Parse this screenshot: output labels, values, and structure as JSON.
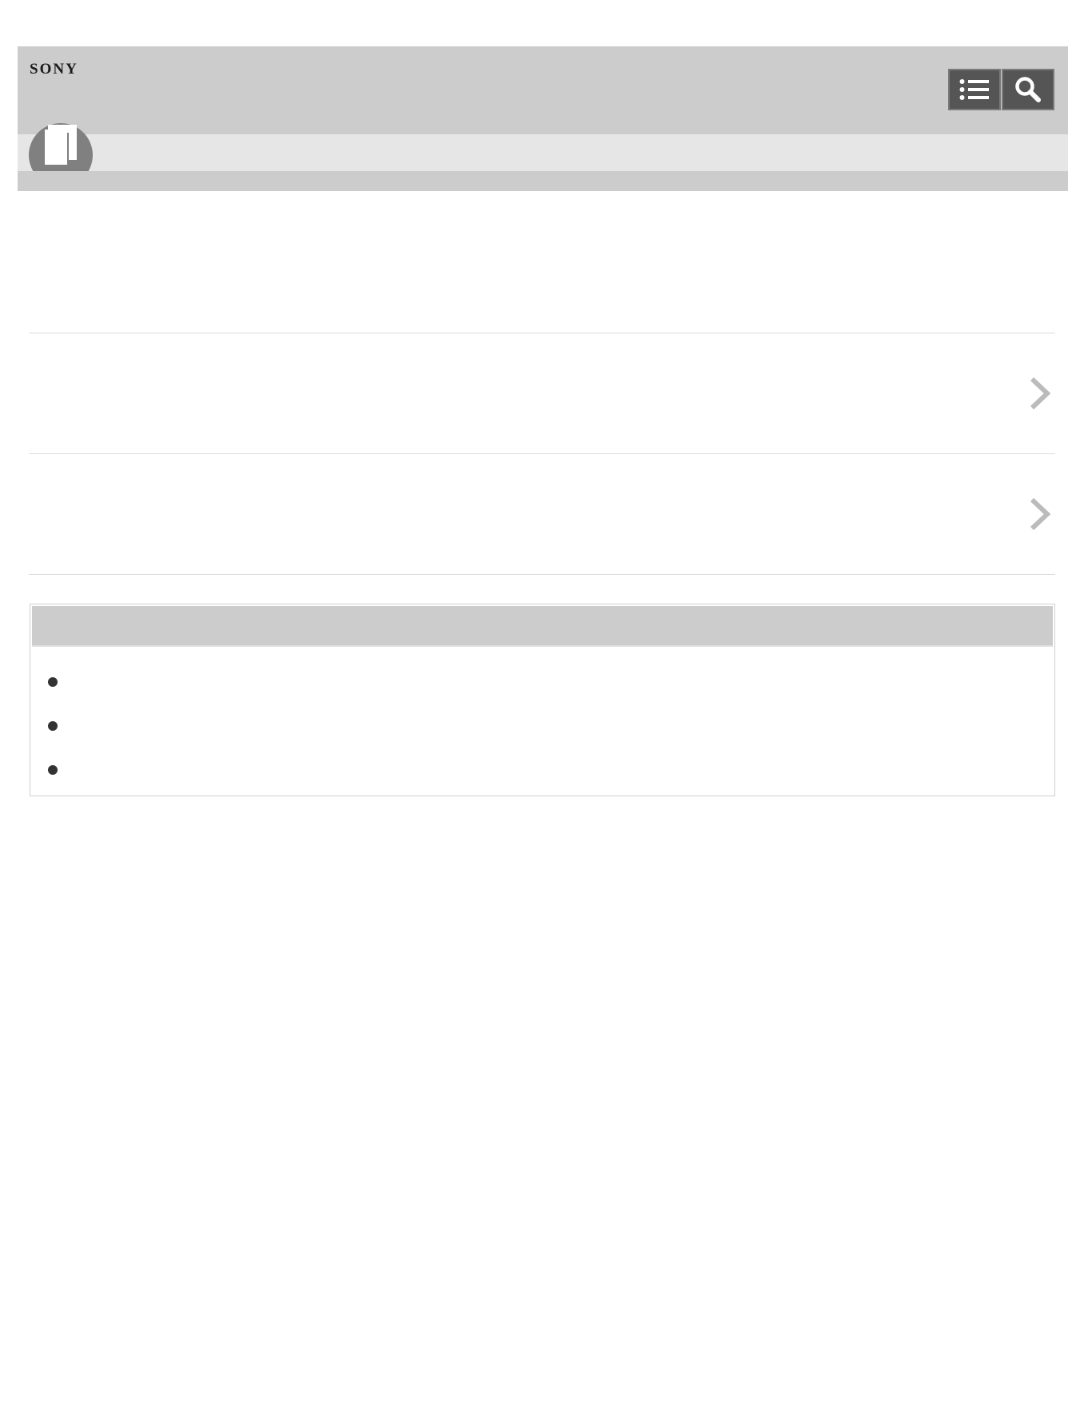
{
  "header": {
    "brand": "SONY",
    "toc_icon": "list-icon",
    "search_icon": "search-icon",
    "manual_icon": "manual-book-icon"
  },
  "main": {
    "title": "",
    "items": [
      {
        "label": "",
        "icon": "chevron-right-icon"
      },
      {
        "label": "",
        "icon": "chevron-right-icon"
      }
    ]
  },
  "related": {
    "heading": "",
    "links": [
      {
        "label": ""
      },
      {
        "label": ""
      },
      {
        "label": ""
      }
    ]
  },
  "colors": {
    "header_bg": "#cccccc",
    "subbar_bg": "#e6e6e6",
    "button_bg": "#555555",
    "chevron": "#bbbbbb"
  }
}
